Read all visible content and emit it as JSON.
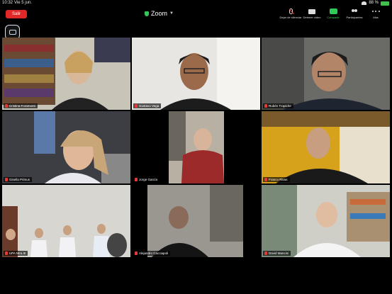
{
  "status_bar": {
    "time": "10:32",
    "date": "Vie 5 jun.",
    "battery": "88 %"
  },
  "header": {
    "leave_label": "Salir",
    "title": "Zoom",
    "tools": [
      {
        "label": "Dejar de silenciar",
        "icon": "mic-muted-icon"
      },
      {
        "label": "Detener video",
        "icon": "video-camera-icon"
      },
      {
        "label": "Compartir",
        "icon": "share-screen-icon"
      },
      {
        "label": "Participantes",
        "icon": "participants-icon"
      },
      {
        "label": "Más",
        "icon": "more-icon"
      }
    ]
  },
  "side": {
    "camera_label": "Intercambiar cámara"
  },
  "participants": [
    {
      "name": "Cristina Foramonti",
      "muted": true
    },
    {
      "name": "Gustavo Vega",
      "muted": true
    },
    {
      "name": "Rubén Tropiche",
      "muted": true
    },
    {
      "name": "Gisella Primus",
      "muted": true
    },
    {
      "name": "Jorge García",
      "muted": true
    },
    {
      "name": "Franco Rivas",
      "muted": true
    },
    {
      "name": "UPA Ntra.III",
      "muted": true
    },
    {
      "name": "Alejandro Cacciapoli",
      "muted": true
    },
    {
      "name": "David Mancini",
      "muted": true
    }
  ],
  "colors": {
    "leave": "#e02828",
    "share": "#2ecc55",
    "muted": "#e53935",
    "active_speaker": "#3fcf5a"
  }
}
